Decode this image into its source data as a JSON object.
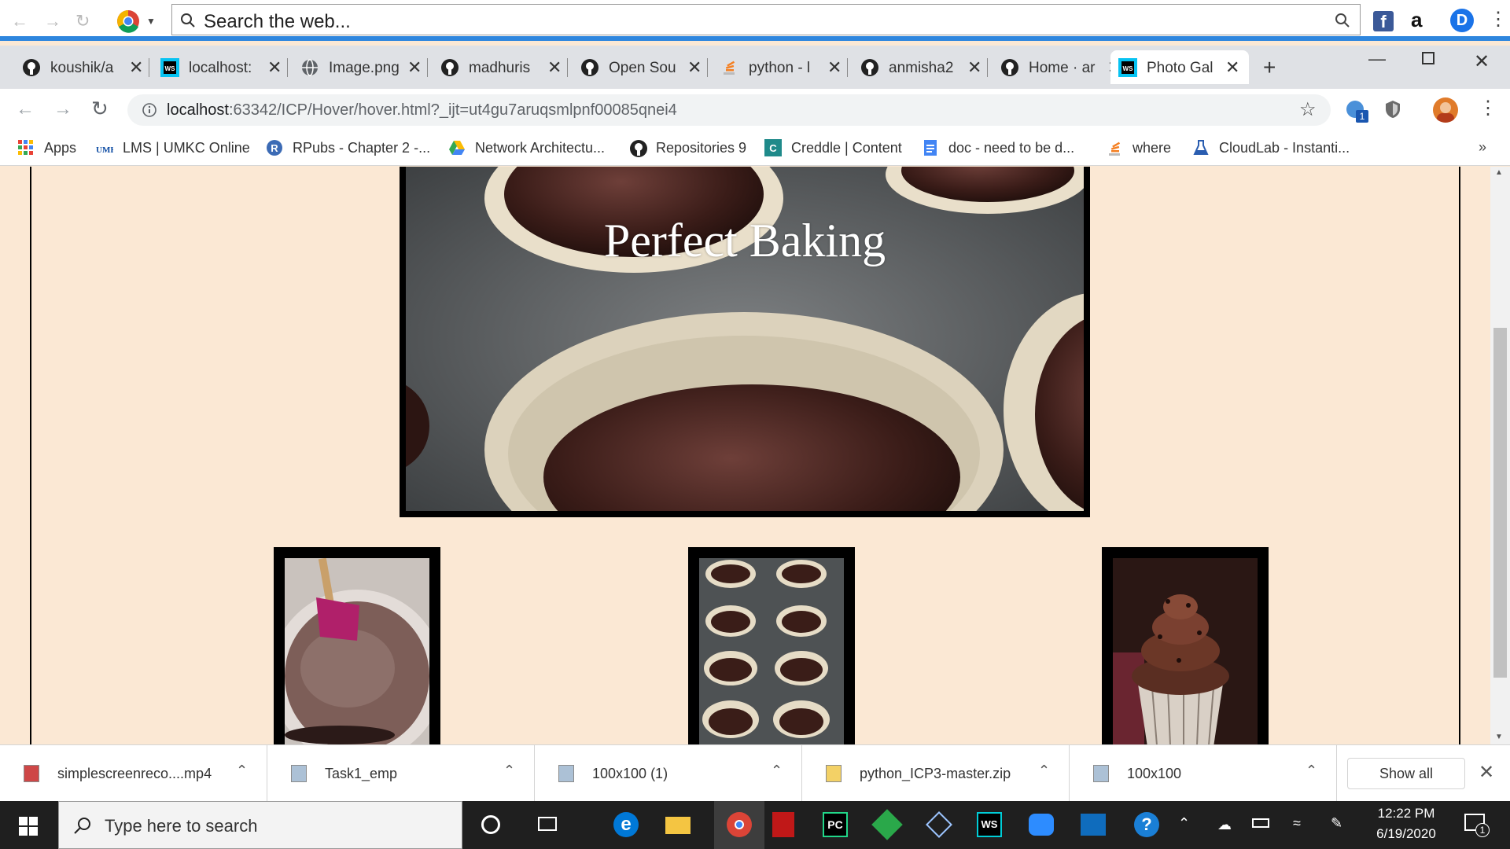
{
  "top_toolbar": {
    "search_placeholder": "Search the web..."
  },
  "tabs": [
    {
      "label": "koushik/a",
      "icon": "github-icon"
    },
    {
      "label": "localhost:",
      "icon": "webstorm-icon"
    },
    {
      "label": "Image.png",
      "icon": "globe-icon"
    },
    {
      "label": "madhuris",
      "icon": "github-icon"
    },
    {
      "label": "Open Sou",
      "icon": "github-icon"
    },
    {
      "label": "python - l",
      "icon": "stackoverflow-icon"
    },
    {
      "label": "anmisha2",
      "icon": "github-icon"
    },
    {
      "label": "Home · ar",
      "icon": "github-icon"
    },
    {
      "label": "Photo Gal",
      "icon": "webstorm-icon",
      "active": true
    }
  ],
  "address_bar": {
    "url_host": "localhost",
    "url_rest": ":63342/ICP/Hover/hover.html?_ijt=ut4gu7aruqsmlpnf00085qnei4",
    "extension_badge": "1"
  },
  "bookmarks": [
    {
      "label": "Apps",
      "icon": "apps-grid-icon"
    },
    {
      "label": "LMS | UMKC Online",
      "icon": "umkc-icon"
    },
    {
      "label": "RPubs - Chapter 2 -...",
      "icon": "rpubs-icon"
    },
    {
      "label": "Network Architectu...",
      "icon": "drive-icon"
    },
    {
      "label": "Repositories 9",
      "icon": "github-icon"
    },
    {
      "label": "Creddle | Content",
      "icon": "creddle-icon"
    },
    {
      "label": "doc - need to be d...",
      "icon": "docs-icon"
    },
    {
      "label": "where",
      "icon": "stackoverflow-icon"
    },
    {
      "label": "CloudLab - Instanti...",
      "icon": "cloudlab-icon"
    }
  ],
  "page": {
    "hero_title": "Perfect Baking",
    "thumbnails": [
      {
        "name": "thumbnail-batter-bowl"
      },
      {
        "name": "thumbnail-cupcake-tray"
      },
      {
        "name": "thumbnail-frosted-cupcake"
      }
    ]
  },
  "downloads": {
    "items": [
      {
        "label": "simplescreenreco....mp4"
      },
      {
        "label": "Task1_emp"
      },
      {
        "label": "100x100 (1)"
      },
      {
        "label": "python_ICP3-master.zip"
      },
      {
        "label": "100x100"
      }
    ],
    "show_all": "Show all"
  },
  "taskbar": {
    "search_placeholder": "Type here to search",
    "time": "12:22 PM",
    "date": "6/19/2020",
    "notification_count": "1"
  },
  "colors": {
    "page_background": "#fbe8d4",
    "accent_blue": "#2e86de",
    "taskbar": "#1f1f1f"
  }
}
